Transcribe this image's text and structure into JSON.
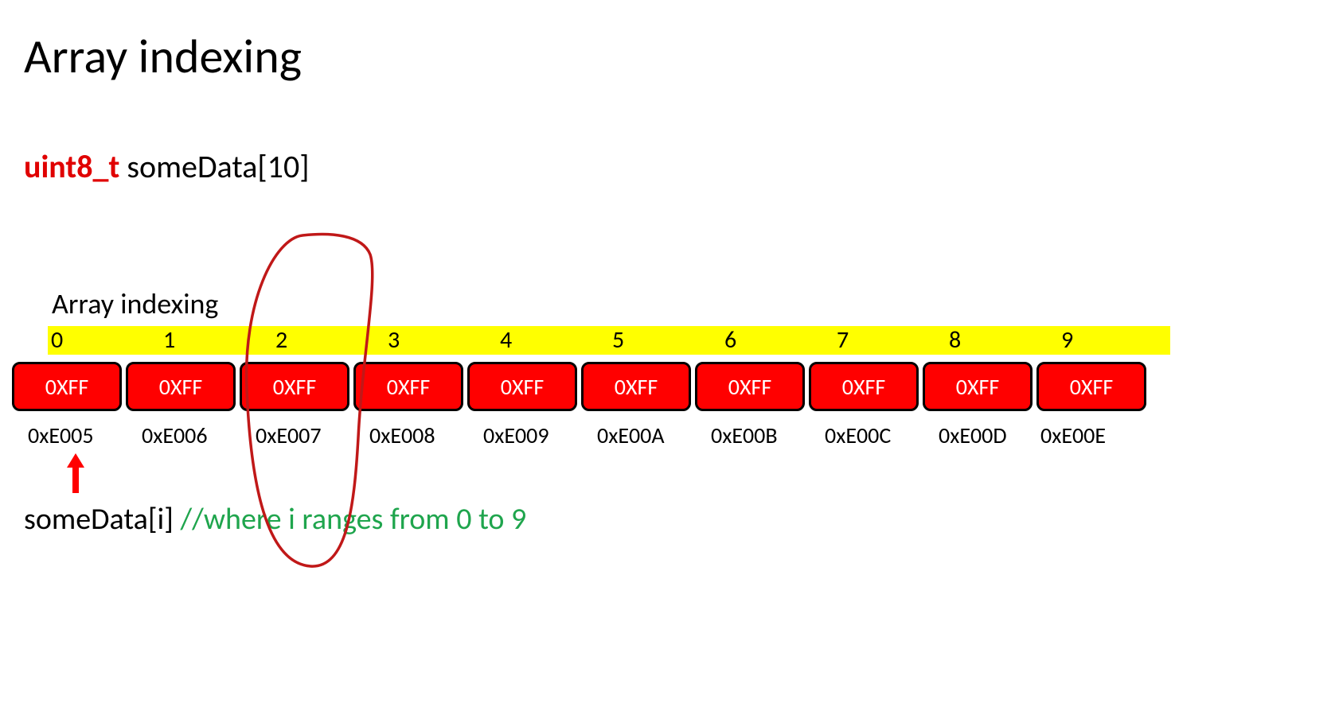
{
  "title": "Array indexing",
  "declaration": {
    "type": "uint8_t",
    "rest": " someData[10]"
  },
  "subtitle": "Array indexing",
  "indices": [
    "0",
    "1",
    "2",
    "3",
    "4",
    "5",
    "6",
    "7",
    "8",
    "9"
  ],
  "cells": [
    "0XFF",
    "0XFF",
    "0XFF",
    "0XFF",
    "0XFF",
    "0XFF",
    "0XFF",
    "0XFF",
    "0XFF",
    "0XFF"
  ],
  "addresses": [
    "0xE005",
    "0xE006",
    "0xE007",
    "0xE008",
    "0xE009",
    "0xE00A",
    "0xE00B",
    "0xE00C",
    "0xE00D",
    "0xE00E"
  ],
  "expression": {
    "code": "someData[i]  ",
    "comment": "//where  i  ranges from 0 to 9"
  }
}
